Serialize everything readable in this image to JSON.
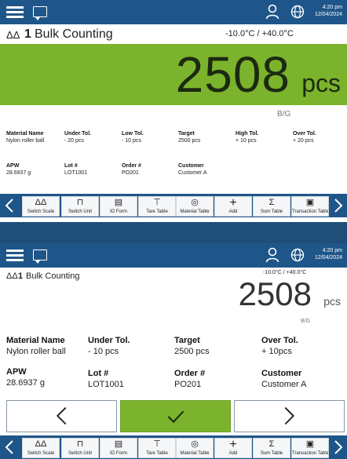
{
  "colors": {
    "bar": "#1f5689",
    "accent_green": "#7bb42c",
    "background": "#1f4e79"
  },
  "status": {
    "time": "4:20 pm",
    "date": "12/04/2024"
  },
  "icons": {
    "menu": "hamburger-menu-icon",
    "messages": "chat-icon",
    "user": "user-icon",
    "globe": "globe-icon"
  },
  "panel1": {
    "title_number": "1",
    "title_name": "Bulk Counting",
    "temp_range": "-10.0°C / +40.0°C",
    "weight": "2508",
    "unit": "pcs",
    "mode": "B/G",
    "fields": [
      {
        "label": "Material Name",
        "value": "Nylon roller ball"
      },
      {
        "label": "Under Tol.",
        "value": "- 20 pcs"
      },
      {
        "label": "Low Tol.",
        "value": "- 10 pcs"
      },
      {
        "label": "Target",
        "value": "2500 pcs"
      },
      {
        "label": "High Tol.",
        "value": "+ 10 pcs"
      },
      {
        "label": "Over Tol.",
        "value": "+ 20 pcs"
      },
      {
        "label": "APW",
        "value": "28.6937 g"
      },
      {
        "label": "Lot #",
        "value": "LOT1001"
      },
      {
        "label": "Order #",
        "value": "PO201"
      },
      {
        "label": "Customer",
        "value": "Customer A"
      }
    ]
  },
  "panel2": {
    "title_number": "1",
    "title_name": "Bulk Counting",
    "temp_range": "-10.0°C / +40.0°C",
    "weight": "2508",
    "unit": "pcs",
    "mode": "B/G",
    "fields": [
      {
        "label": "Material Name",
        "value": "Nylon roller ball"
      },
      {
        "label": "Under Tol.",
        "value": "- 10 pcs"
      },
      {
        "label": "Target",
        "value": "2500 pcs"
      },
      {
        "label": "Over Tol.",
        "value": "+ 10pcs"
      },
      {
        "label": "APW",
        "value": "28.6937 g"
      },
      {
        "label": "Lot #",
        "value": "LOT1001"
      },
      {
        "label": "Order #",
        "value": "PO201"
      },
      {
        "label": "Customer",
        "value": "Customer A"
      }
    ]
  },
  "softkeys": [
    {
      "label": "Switch Scale",
      "icon": "scale-icon"
    },
    {
      "label": "Switch Unit",
      "icon": "weight-icon"
    },
    {
      "label": "ID Form",
      "icon": "form-icon"
    },
    {
      "label": "Tare Table",
      "icon": "tare-icon"
    },
    {
      "label": "Material Table",
      "icon": "material-icon"
    },
    {
      "label": "Add",
      "icon": "plus-icon"
    },
    {
      "label": "Sum Table",
      "icon": "sum-icon"
    },
    {
      "label": "Transaction Table",
      "icon": "transaction-icon"
    }
  ]
}
